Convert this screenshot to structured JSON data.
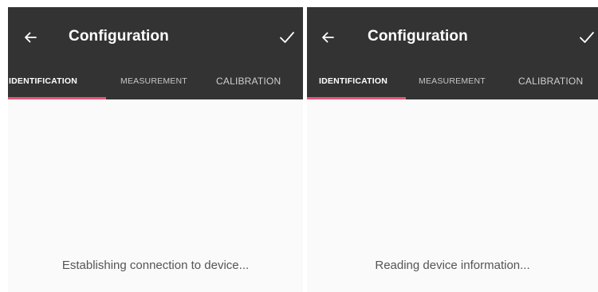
{
  "screens": [
    {
      "toolbar": {
        "back_icon": "arrow-left-icon",
        "title": "Configuration",
        "confirm_icon": "check-icon"
      },
      "tabs": [
        {
          "label": "IDENTIFICATION",
          "selected": true
        },
        {
          "label": "MEASUREMENT",
          "selected": false
        },
        {
          "label": "CALIBRATION",
          "selected": false
        }
      ],
      "status_message": "Establishing connection to device..."
    },
    {
      "toolbar": {
        "back_icon": "arrow-left-icon",
        "title": "Configuration",
        "confirm_icon": "check-icon"
      },
      "tabs": [
        {
          "label": "IDENTIFICATION",
          "selected": true
        },
        {
          "label": "MEASUREMENT",
          "selected": false
        },
        {
          "label": "CALIBRATION",
          "selected": false
        }
      ],
      "status_message": "Reading device information..."
    }
  ],
  "colors": {
    "appbar": "#333333",
    "indicator": "#e5567a",
    "background": "#fafafa",
    "status_text": "#555555"
  }
}
